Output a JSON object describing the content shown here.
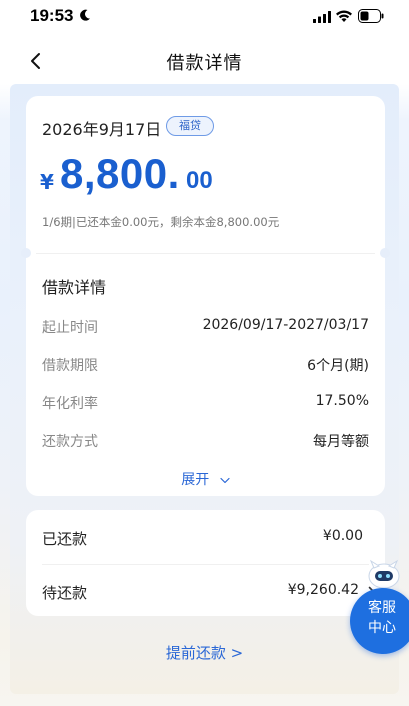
{
  "status_bar": {
    "time": "19:53",
    "icons": [
      "moon-icon",
      "signal-icon",
      "wifi-icon",
      "battery-icon"
    ]
  },
  "nav": {
    "title": "借款详情",
    "back_icon": "back-chevron-icon"
  },
  "loan": {
    "date": "2026年9月17日",
    "badge": "福贷",
    "currency_symbol": "¥",
    "amount_integer": "8,800.",
    "amount_decimal": "00",
    "progress_text": "1/6期|已还本金0.00元，剩余本金8,800.00元"
  },
  "details": {
    "title": "借款详情",
    "rows": [
      {
        "label": "起止时间",
        "value": "2026/09/17-2027/03/17"
      },
      {
        "label": "借款期限",
        "value": "6个月(期)"
      },
      {
        "label": "年化利率",
        "value": "17.50%"
      },
      {
        "label": "还款方式",
        "value": "每月等额"
      }
    ],
    "expand_label": "展开"
  },
  "repayment": {
    "paid_label": "已还款",
    "paid_value": "¥0.00",
    "pending_label": "待还款",
    "pending_value": "¥9,260.42"
  },
  "prepay_label": "提前还款 >",
  "customer_service": {
    "line1": "客服",
    "line2": "中心"
  },
  "colors": {
    "accent": "#1a5fcf",
    "link": "#2a67d6",
    "cs_bubble": "#1e6fe0"
  }
}
